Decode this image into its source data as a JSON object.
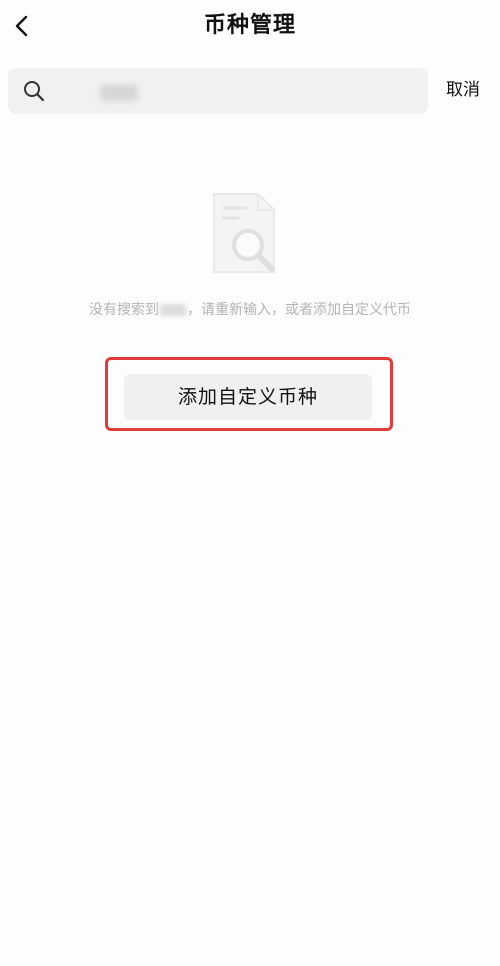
{
  "header": {
    "title": "币种管理",
    "back_icon": "chevron-left-icon"
  },
  "search": {
    "icon": "search-icon",
    "value": "",
    "cancel_label": "取消"
  },
  "empty_state": {
    "icon": "document-search-icon",
    "message_prefix": "没有搜索到",
    "message_suffix": "，请重新输入，或者添加自定义代币"
  },
  "actions": {
    "add_custom_label": "添加自定义币种",
    "highlight_color": "#e23b3b"
  }
}
